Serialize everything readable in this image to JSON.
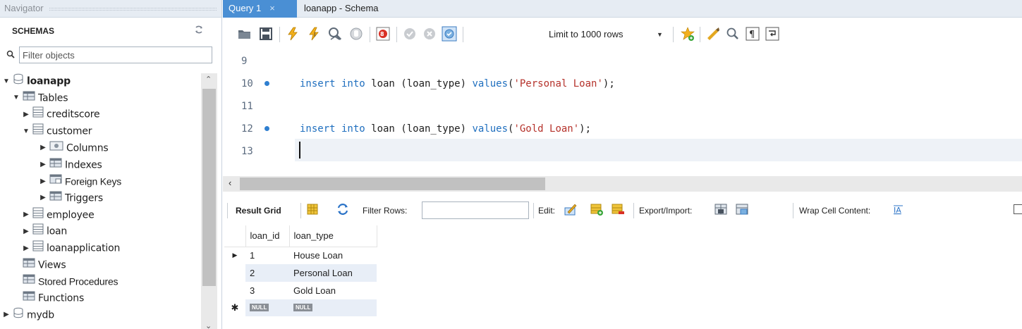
{
  "navigator": {
    "title": "Navigator",
    "schemas_label": "SCHEMAS",
    "filter_placeholder": "Filter objects",
    "tree": [
      {
        "label": "loanapp",
        "kind": "schema"
      },
      {
        "label": "Tables",
        "kind": "folder"
      },
      {
        "label": "creditscore",
        "kind": "table"
      },
      {
        "label": "customer",
        "kind": "table"
      },
      {
        "label": "Columns",
        "kind": "sub"
      },
      {
        "label": "Indexes",
        "kind": "sub"
      },
      {
        "label": "Foreign Keys",
        "kind": "sub"
      },
      {
        "label": "Triggers",
        "kind": "sub"
      },
      {
        "label": "employee",
        "kind": "table"
      },
      {
        "label": "loan",
        "kind": "table"
      },
      {
        "label": "loanapplication",
        "kind": "table"
      },
      {
        "label": "Views",
        "kind": "folder"
      },
      {
        "label": "Stored Procedures",
        "kind": "folder"
      },
      {
        "label": "Functions",
        "kind": "folder"
      },
      {
        "label": "mydb",
        "kind": "schema"
      }
    ]
  },
  "tabs": [
    {
      "label": "Query 1",
      "close": "×"
    },
    {
      "label": "loanapp - Schema"
    }
  ],
  "toolbar": {
    "limit_label": "Limit to 1000 rows"
  },
  "editor": {
    "lines": [
      {
        "num": "9",
        "marker": false,
        "code": []
      },
      {
        "num": "10",
        "marker": true,
        "code": [
          {
            "t": "kw",
            "s": "insert into"
          },
          {
            "t": "plain",
            "s": " loan (loan_type) "
          },
          {
            "t": "kw",
            "s": "values"
          },
          {
            "t": "plain",
            "s": "("
          },
          {
            "t": "str",
            "s": "'Personal Loan'"
          },
          {
            "t": "plain",
            "s": ");"
          }
        ]
      },
      {
        "num": "11",
        "marker": false,
        "code": []
      },
      {
        "num": "12",
        "marker": true,
        "code": [
          {
            "t": "kw",
            "s": "insert into"
          },
          {
            "t": "plain",
            "s": " loan (loan_type) "
          },
          {
            "t": "kw",
            "s": "values"
          },
          {
            "t": "plain",
            "s": "("
          },
          {
            "t": "str",
            "s": "'Gold Loan'"
          },
          {
            "t": "plain",
            "s": ");"
          }
        ]
      },
      {
        "num": "13",
        "marker": false,
        "code": []
      }
    ]
  },
  "result_toolbar": {
    "result_grid": "Result Grid",
    "filter_rows": "Filter Rows:",
    "edit": "Edit:",
    "export_import": "Export/Import:",
    "wrap_cell": "Wrap Cell Content:"
  },
  "grid": {
    "columns": [
      "loan_id",
      "loan_type"
    ],
    "rows": [
      [
        "1",
        "House Loan"
      ],
      [
        "2",
        "Personal Loan"
      ],
      [
        "3",
        "Gold Loan"
      ]
    ],
    "null_label": "NULL"
  },
  "colors": {
    "accent": "#4a8fd4",
    "keyword": "#1f6fbf",
    "string": "#b5322b"
  }
}
